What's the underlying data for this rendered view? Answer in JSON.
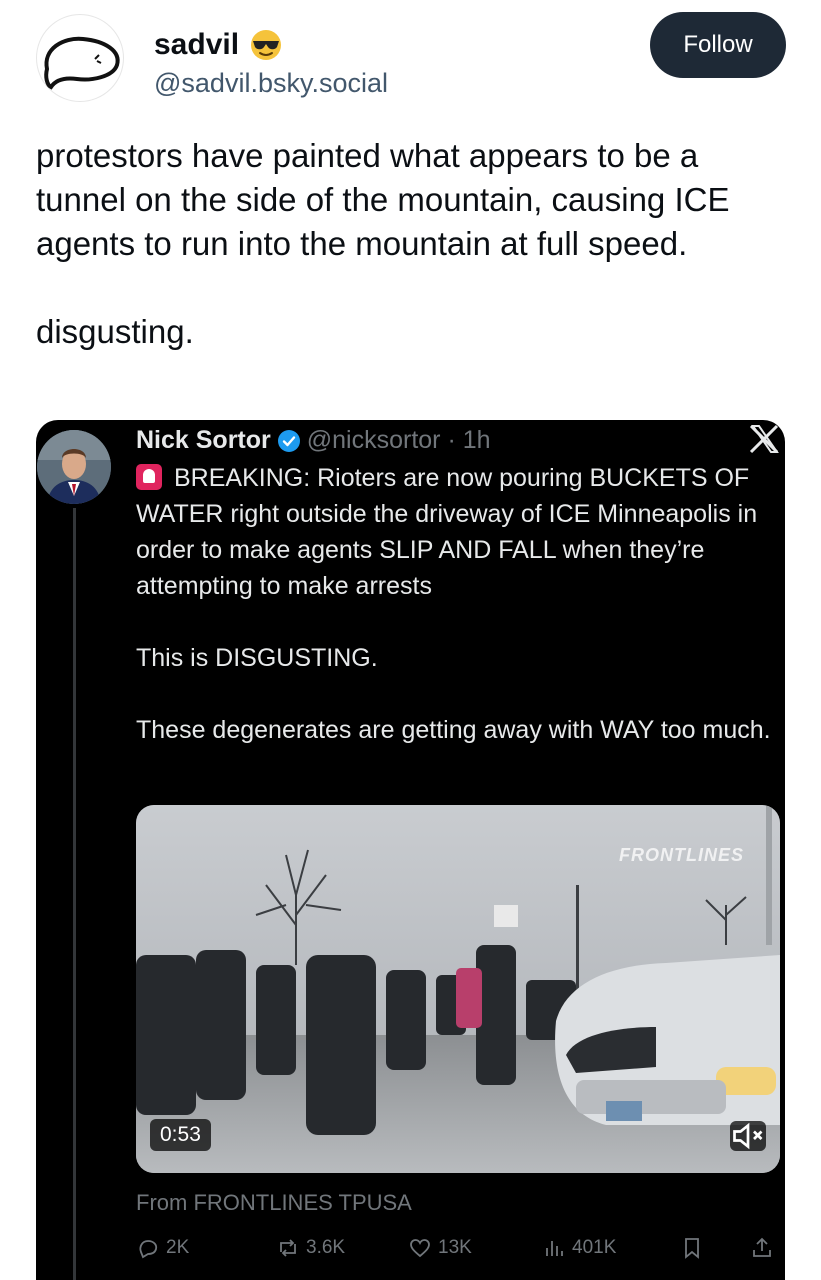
{
  "author": {
    "display_name": "sadvil",
    "handle": "@sadvil.bsky.social",
    "emoji": "sunglasses-emoji"
  },
  "follow_label": "Follow",
  "post": {
    "text": "protestors have painted what appears to be a tunnel on the side of the mountain, causing ICE agents to run into the mountain at full speed.\n\ndisgusting."
  },
  "embed": {
    "name": "Nick Sortor",
    "handle_time": "@nicksortor · 1h",
    "paragraphs": [
      "BREAKING: Rioters are now pouring BUCKETS OF WATER right outside the driveway of ICE Minneapolis in order to make agents SLIP AND FALL when they’re attempting to make arrests",
      "This is DISGUSTING.",
      "These degenerates are getting away with WAY too much."
    ],
    "video": {
      "watermark": "FRONTLINES",
      "duration": "0:53"
    },
    "from": "From FRONTLINES TPUSA",
    "stats": {
      "replies": "2K",
      "reposts": "3.6K",
      "likes": "13K",
      "views": "401K"
    }
  },
  "colors": {
    "follow_bg": "#1e2936",
    "handle": "#42576c",
    "embed_bg": "#000000",
    "muted": "#71767b",
    "verified": "#1d9bf0"
  }
}
